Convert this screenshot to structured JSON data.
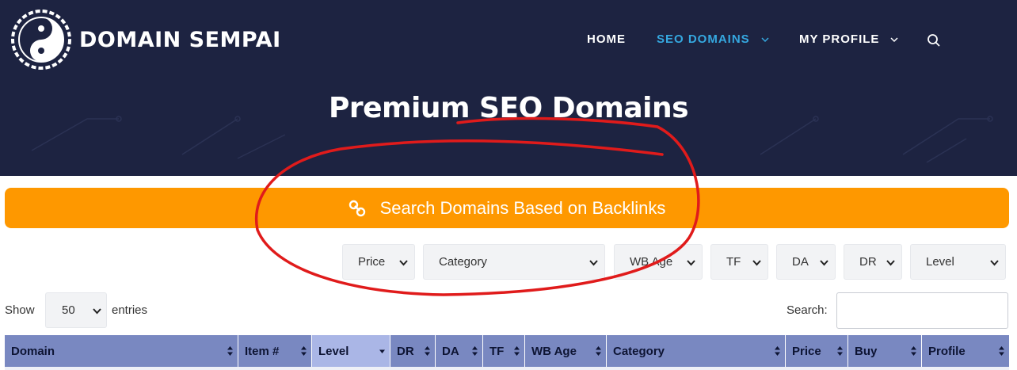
{
  "header": {
    "logo_text": "DOMAIN SEMPAI",
    "nav": [
      {
        "label": "HOME",
        "has_dropdown": false,
        "active": false
      },
      {
        "label": "SEO DOMAINS",
        "has_dropdown": true,
        "active": true
      },
      {
        "label": "MY PROFILE",
        "has_dropdown": true,
        "active": false
      }
    ],
    "search_icon": "search-icon",
    "page_title": "Premium SEO Domains"
  },
  "cta": {
    "icon": "link-icon",
    "label": "Search Domains Based on Backlinks"
  },
  "filters": [
    {
      "label": "Price"
    },
    {
      "label": "Category"
    },
    {
      "label": "WB Age"
    },
    {
      "label": "TF"
    },
    {
      "label": "DA"
    },
    {
      "label": "DR"
    },
    {
      "label": "Level"
    }
  ],
  "table_controls": {
    "show_label": "Show",
    "entries_value": "50",
    "entries_label": "entries",
    "search_label": "Search:"
  },
  "table": {
    "columns": [
      "Domain",
      "Item #",
      "Level",
      "DR",
      "DA",
      "TF",
      "WB Age",
      "Category",
      "Price",
      "Buy",
      "Profile"
    ],
    "sorted_column": "Level"
  },
  "colors": {
    "header_bg": "#1d2341",
    "nav_active": "#35a8e0",
    "cta_bg": "#fe9800",
    "table_header_bg": "#7988c1",
    "table_header_sorted_bg": "#aab6e6",
    "annotation": "#e01b1b"
  }
}
